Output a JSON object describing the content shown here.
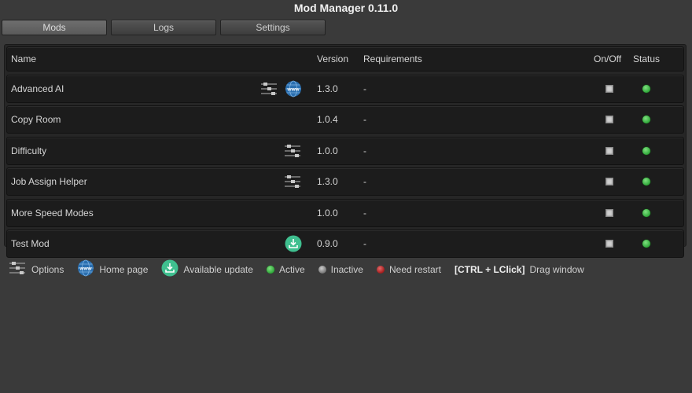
{
  "window": {
    "title": "Mod Manager 0.11.0"
  },
  "tabs": [
    {
      "label": "Mods",
      "active": true
    },
    {
      "label": "Logs",
      "active": false
    },
    {
      "label": "Settings",
      "active": false
    }
  ],
  "table": {
    "columns": {
      "name": "Name",
      "version": "Version",
      "requirements": "Requirements",
      "onoff": "On/Off",
      "status": "Status"
    },
    "rows": [
      {
        "name": "Advanced AI",
        "icons": [
          "options-icon",
          "homepage-icon"
        ],
        "version": "1.3.0",
        "requirements": "-",
        "enabled": true,
        "status": "active"
      },
      {
        "name": "Copy Room",
        "icons": [],
        "version": "1.0.4",
        "requirements": "-",
        "enabled": true,
        "status": "active"
      },
      {
        "name": "Difficulty",
        "icons": [
          "options-icon"
        ],
        "version": "1.0.0",
        "requirements": "-",
        "enabled": true,
        "status": "active"
      },
      {
        "name": "Job Assign Helper",
        "icons": [
          "options-icon"
        ],
        "version": "1.3.0",
        "requirements": "-",
        "enabled": true,
        "status": "active"
      },
      {
        "name": "More Speed Modes",
        "icons": [],
        "version": "1.0.0",
        "requirements": "-",
        "enabled": true,
        "status": "active"
      },
      {
        "name": "Test Mod",
        "icons": [
          "update-icon"
        ],
        "version": "0.9.0",
        "requirements": "-",
        "enabled": true,
        "status": "active"
      }
    ]
  },
  "legend": {
    "options": "Options",
    "homepage": "Home page",
    "update": "Available update",
    "active": "Active",
    "inactive": "Inactive",
    "restart": "Need restart",
    "shortcut": "[CTRL + LClick]",
    "shortcut_desc": "Drag window"
  },
  "colors": {
    "active": "#3cb043",
    "inactive": "#8a8a8a",
    "restart": "#b02020",
    "update": "#3fbf8f",
    "homepage": "#2a6fb0"
  }
}
